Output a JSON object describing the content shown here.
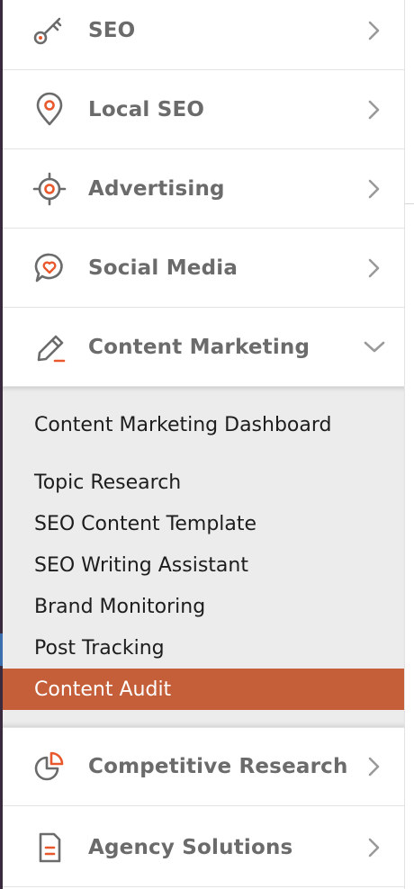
{
  "colors": {
    "accent": "#e9582c",
    "icon_gray": "#6b6b6b",
    "active_bg": "#c45f3a",
    "submenu_bg": "#ececec"
  },
  "menu": {
    "items": [
      {
        "label": "SEO",
        "icon": "key-icon",
        "expanded": false
      },
      {
        "label": "Local SEO",
        "icon": "map-pin-icon",
        "expanded": false
      },
      {
        "label": "Advertising",
        "icon": "target-icon",
        "expanded": false
      },
      {
        "label": "Social Media",
        "icon": "chat-heart-icon",
        "expanded": false
      },
      {
        "label": "Content Marketing",
        "icon": "pencil-icon",
        "expanded": true
      },
      {
        "label": "Competitive Research",
        "icon": "pie-chart-icon",
        "expanded": false
      },
      {
        "label": "Agency Solutions",
        "icon": "document-icon",
        "expanded": false
      }
    ]
  },
  "submenu": {
    "items": [
      {
        "label": "Content Marketing Dashboard",
        "active": false
      },
      {
        "label": "Topic Research",
        "active": false
      },
      {
        "label": "SEO Content Template",
        "active": false
      },
      {
        "label": "SEO Writing Assistant",
        "active": false
      },
      {
        "label": "Brand Monitoring",
        "active": false
      },
      {
        "label": "Post Tracking",
        "active": false
      },
      {
        "label": "Content Audit",
        "active": true
      }
    ]
  }
}
